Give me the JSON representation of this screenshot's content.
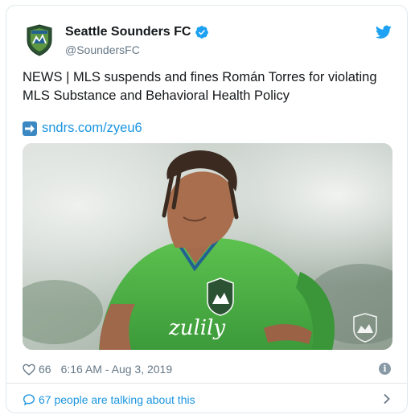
{
  "tweet": {
    "display_name": "Seattle Sounders FC",
    "handle": "@SoundersFC",
    "text": "NEWS | MLS suspends and fines Román Torres for violating MLS Substance and Behavioral Health Policy",
    "link_text": "sndrs.com/zyeu6",
    "like_count": "66",
    "timestamp": "6:16 AM - Aug 3, 2019",
    "conversation_text": "67 people are talking about this",
    "jersey_sponsor": "zulily"
  },
  "colors": {
    "link": "#1b95e0",
    "verified": "#1da1f2",
    "secondary_text": "#657786",
    "jersey_green": "#4fb548"
  },
  "icons": {
    "avatar": "sounders-crest-icon",
    "verified": "verified-badge-icon",
    "brand": "twitter-bird-icon",
    "link": "right-arrow-emoji-icon",
    "like": "heart-outline-icon",
    "info": "info-icon",
    "conversation": "speech-bubble-icon",
    "expand": "chevron-right-icon"
  }
}
